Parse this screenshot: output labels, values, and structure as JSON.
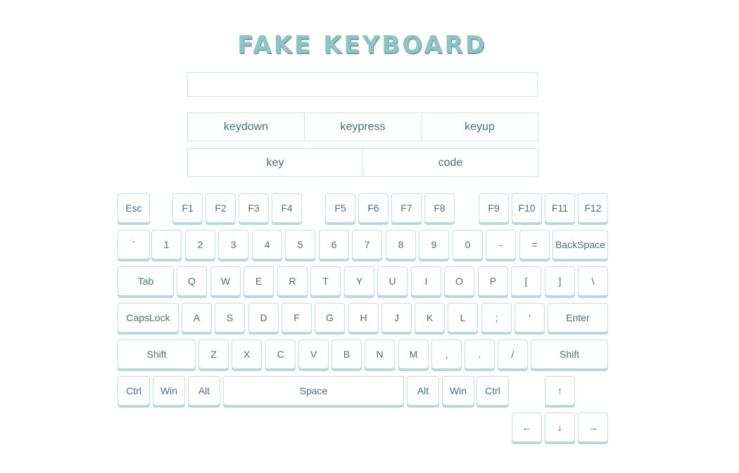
{
  "title": "FAKE KEYBOARD",
  "input": {
    "value": "",
    "placeholder": ""
  },
  "events": [
    "keydown",
    "keypress",
    "keyup"
  ],
  "key_info": [
    "key",
    "code"
  ],
  "keyboard": {
    "row1": [
      "Esc",
      "F1",
      "F2",
      "F3",
      "F4",
      "F5",
      "F6",
      "F7",
      "F8",
      "F9",
      "F10",
      "F11",
      "F12"
    ],
    "row2": [
      "`",
      "1",
      "2",
      "3",
      "4",
      "5",
      "6",
      "7",
      "8",
      "9",
      "0",
      "-",
      "=",
      "BackSpace"
    ],
    "row3": [
      "Tab",
      "Q",
      "W",
      "E",
      "R",
      "T",
      "Y",
      "U",
      "I",
      "O",
      "P",
      "[",
      "]",
      "\\"
    ],
    "row4": [
      "CapsLock",
      "A",
      "S",
      "D",
      "F",
      "G",
      "H",
      "J",
      "K",
      "L",
      ";",
      "'",
      "Enter"
    ],
    "row5": [
      "Shift",
      "Z",
      "X",
      "C",
      "V",
      "B",
      "N",
      "M",
      ",",
      ".",
      "/",
      "Shift"
    ],
    "row6": [
      "Ctrl",
      "Win",
      "Alt",
      "Space",
      "Alt",
      "Win",
      "Ctrl",
      "↑"
    ],
    "row7": [
      "←",
      "↓",
      "→"
    ]
  },
  "colors": {
    "accent": "#8fc4c4",
    "border": "#c6dfe0",
    "text": "#4e6e7e"
  }
}
